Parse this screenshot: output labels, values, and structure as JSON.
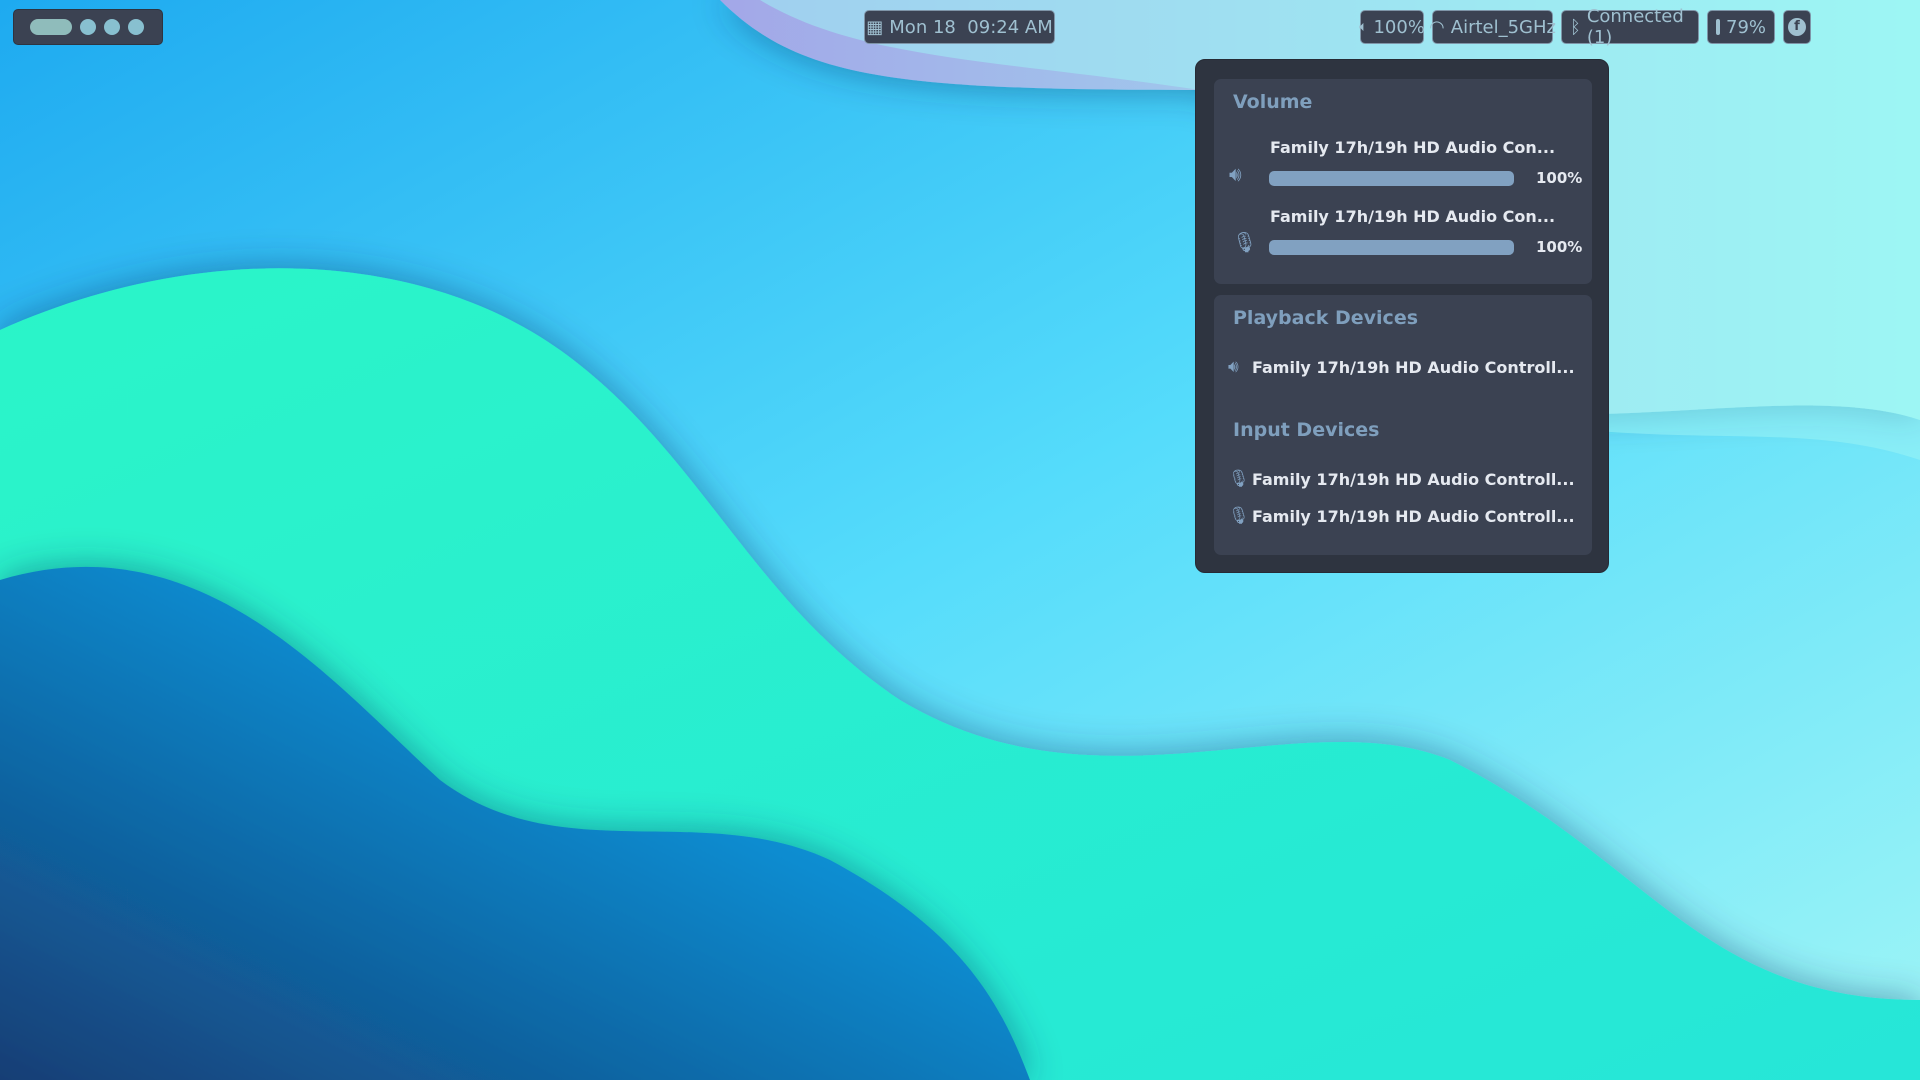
{
  "topbar": {
    "workspaces": {
      "count": 4,
      "active": 1
    },
    "clock": {
      "icon": "calendar-icon",
      "text": "Mon 18  09:24 AM"
    },
    "volume": {
      "icon": "speaker-icon",
      "text": "100%"
    },
    "wifi": {
      "icon": "wifi-icon",
      "text": "Airtel_5GHz"
    },
    "bluetooth": {
      "icon": "bluetooth-icon",
      "text": "Connected (1)"
    },
    "battery": {
      "icon": "battery-icon",
      "text": "79%"
    },
    "distro": {
      "icon": "fedora-icon"
    }
  },
  "audio_menu": {
    "volume": {
      "title": "Volume",
      "output": {
        "name": "Family 17h/19h HD Audio Con...",
        "label": "100%",
        "level": 100
      },
      "input": {
        "name": "Family 17h/19h HD Audio Con...",
        "label": "100%",
        "level": 100
      }
    },
    "playback": {
      "title": "Playback Devices",
      "devices": [
        "Family 17h/19h HD Audio Controll..."
      ]
    },
    "inputs": {
      "title": "Input Devices",
      "devices": [
        "Family 17h/19h HD Audio Controll...",
        "Family 17h/19h HD Audio Controll..."
      ]
    }
  }
}
